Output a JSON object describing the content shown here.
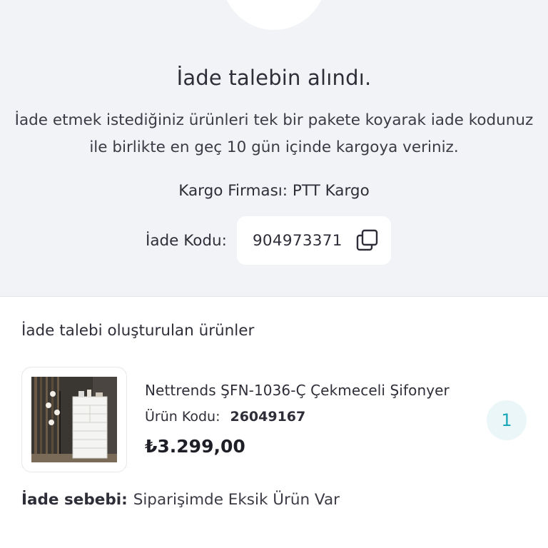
{
  "status": {
    "title": "İade talebin alındı.",
    "instructions": "İade etmek istediğiniz ürünleri tek bir pakete koyarak iade kodunuz ile birlikte en geç 10 gün içinde kargoya veriniz.",
    "cargo_label": "Kargo Firması:",
    "cargo_value": "PTT Kargo",
    "code_label": "İade Kodu:",
    "code_value": "904973371",
    "copy_icon": "copy-icon"
  },
  "products_section": {
    "title": "İade talebi oluşturulan ürünler",
    "items": [
      {
        "name": "Nettrends ŞFN-1036-Ç Çekmeceli Şifonyer",
        "code_label": "Ürün Kodu:",
        "code_value": "26049167",
        "price": "₺3.299,00",
        "quantity": "1"
      }
    ]
  },
  "reason": {
    "label": "İade sebebi:",
    "value": "Siparişimde Eksik Ürün Var"
  },
  "colors": {
    "top_background": "#f2f3f7",
    "accent": "#1aa7b8",
    "badge_background": "#eaf6f8"
  }
}
